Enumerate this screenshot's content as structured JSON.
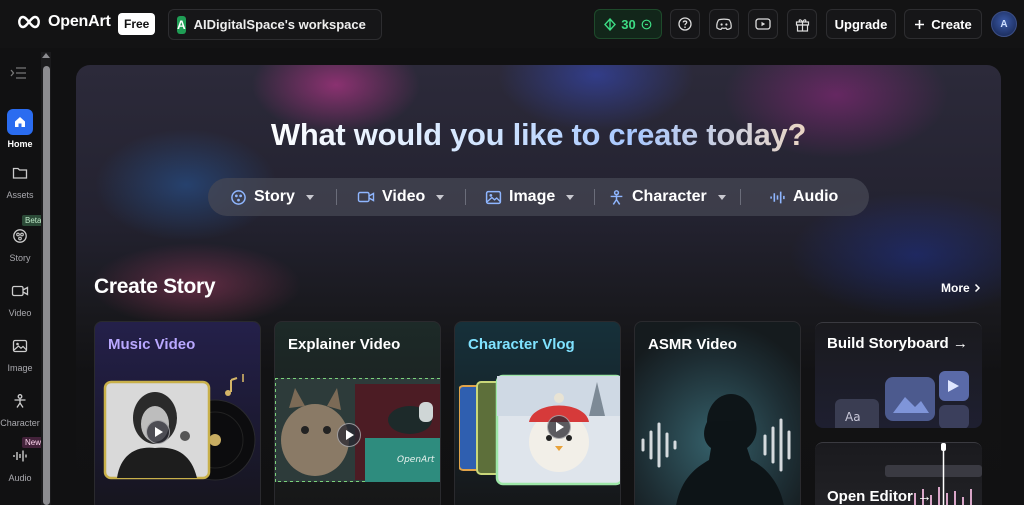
{
  "topbar": {
    "brand": "OpenArt",
    "plan_badge": "Free",
    "workspace_initial": "A",
    "workspace_name": "AIDigitalSpace's workspace",
    "credits": "30",
    "upgrade_label": "Upgrade",
    "create_label": "Create",
    "user_initials": "A"
  },
  "sidebar": {
    "items": [
      {
        "label": "Home",
        "icon": "home-icon"
      },
      {
        "label": "Assets",
        "icon": "folder-icon"
      },
      {
        "label": "Story",
        "icon": "story-icon"
      },
      {
        "label": "Video",
        "icon": "video-icon"
      },
      {
        "label": "Image",
        "icon": "image-icon"
      },
      {
        "label": "Character",
        "icon": "character-icon"
      },
      {
        "label": "Audio",
        "icon": "audio-icon"
      }
    ],
    "beta_tag": "Beta",
    "new_tag": "New"
  },
  "hero": {
    "title": "What would you like to create today?",
    "types": [
      {
        "label": "Story"
      },
      {
        "label": "Video"
      },
      {
        "label": "Image"
      },
      {
        "label": "Character"
      },
      {
        "label": "Audio"
      }
    ]
  },
  "create_story": {
    "title": "Create Story",
    "more_label": "More",
    "cards": [
      {
        "title": "Music Video"
      },
      {
        "title": "Explainer Video"
      },
      {
        "title": "Character Vlog"
      },
      {
        "title": "ASMR Video"
      }
    ],
    "side_cards": [
      {
        "title": "Build Storyboard →",
        "thumb_text": "Aa"
      },
      {
        "title": "Open Editor →"
      }
    ],
    "explainer_watermark": "OpenArt"
  },
  "colors": {
    "accent_blue": "#2a6cf0",
    "credits_green": "#3ddc84",
    "music_video_title": "#b9a8ff",
    "character_vlog_title": "#7fe2ff"
  }
}
